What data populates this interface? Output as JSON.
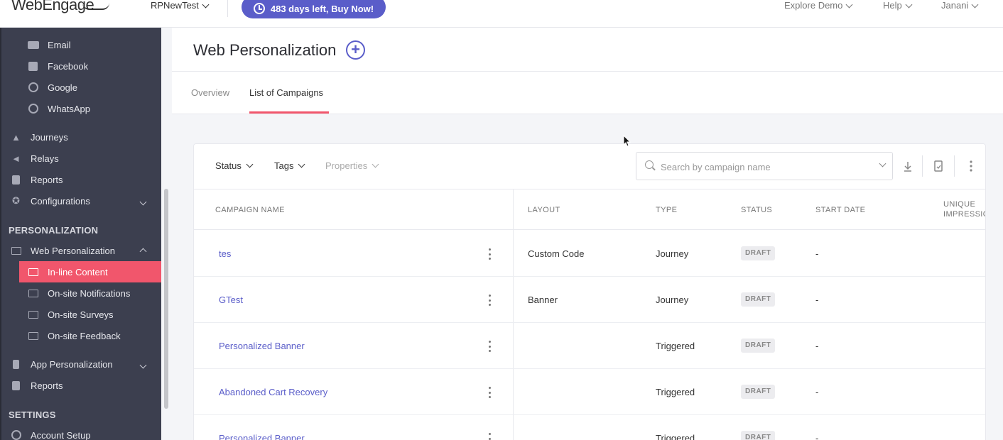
{
  "topbar": {
    "logo": "WebEngage",
    "project": "RPNewTest",
    "trial_days": "483 days left,",
    "trial_cta": "Buy Now!",
    "explore": "Explore Demo",
    "help": "Help",
    "user": "Janani"
  },
  "sidebar": {
    "channel_items": [
      {
        "label": "Email",
        "icon": "email-icon"
      },
      {
        "label": "Facebook",
        "icon": "facebook-icon"
      },
      {
        "label": "Google",
        "icon": "google-icon"
      },
      {
        "label": "WhatsApp",
        "icon": "whatsapp-icon"
      }
    ],
    "top_items": [
      {
        "label": "Journeys",
        "icon": "rocket-icon"
      },
      {
        "label": "Relays",
        "icon": "megaphone-icon"
      },
      {
        "label": "Reports",
        "icon": "report-icon"
      },
      {
        "label": "Configurations",
        "icon": "plug-icon"
      }
    ],
    "personalization_heading": "PERSONALIZATION",
    "web_personalization": "Web Personalization",
    "web_sub_items": [
      {
        "label": "In-line Content",
        "icon": "inline-content-icon",
        "active": true
      },
      {
        "label": "On-site Notifications",
        "icon": "notification-icon"
      },
      {
        "label": "On-site Surveys",
        "icon": "survey-icon"
      },
      {
        "label": "On-site Feedback",
        "icon": "feedback-icon"
      }
    ],
    "app_personalization": "App Personalization",
    "reports": "Reports",
    "settings_heading": "SETTINGS",
    "account_setup": "Account Setup"
  },
  "page": {
    "title": "Web Personalization",
    "add_symbol": "+",
    "tabs": [
      {
        "label": "Overview",
        "active": false
      },
      {
        "label": "List of Campaigns",
        "active": true
      }
    ]
  },
  "filters": {
    "status": "Status",
    "tags": "Tags",
    "properties": "Properties",
    "search_placeholder": "Search by campaign name"
  },
  "table": {
    "headers": {
      "name": "CAMPAIGN NAME",
      "layout": "LAYOUT",
      "type": "TYPE",
      "status": "STATUS",
      "start_date": "START DATE",
      "unique_1": "UNIQUE",
      "unique_2": "IMPRESSIO"
    },
    "rows": [
      {
        "name": "tes",
        "layout": "Custom Code",
        "type": "Journey",
        "status": "DRAFT",
        "start": "-"
      },
      {
        "name": "GTest",
        "layout": "Banner",
        "type": "Journey",
        "status": "DRAFT",
        "start": "-"
      },
      {
        "name": "Personalized Banner",
        "layout": "",
        "type": "Triggered",
        "status": "DRAFT",
        "start": "-"
      },
      {
        "name": "Abandoned Cart Recovery",
        "layout": "",
        "type": "Triggered",
        "status": "DRAFT",
        "start": "-"
      },
      {
        "name": "Personalized Banner",
        "layout": "",
        "type": "Triggered",
        "status": "DRAFT",
        "start": "-"
      }
    ]
  },
  "colors": {
    "brand": "#5a5dc9",
    "active": "#f1566c",
    "sidebar": "#3c3f4f"
  }
}
